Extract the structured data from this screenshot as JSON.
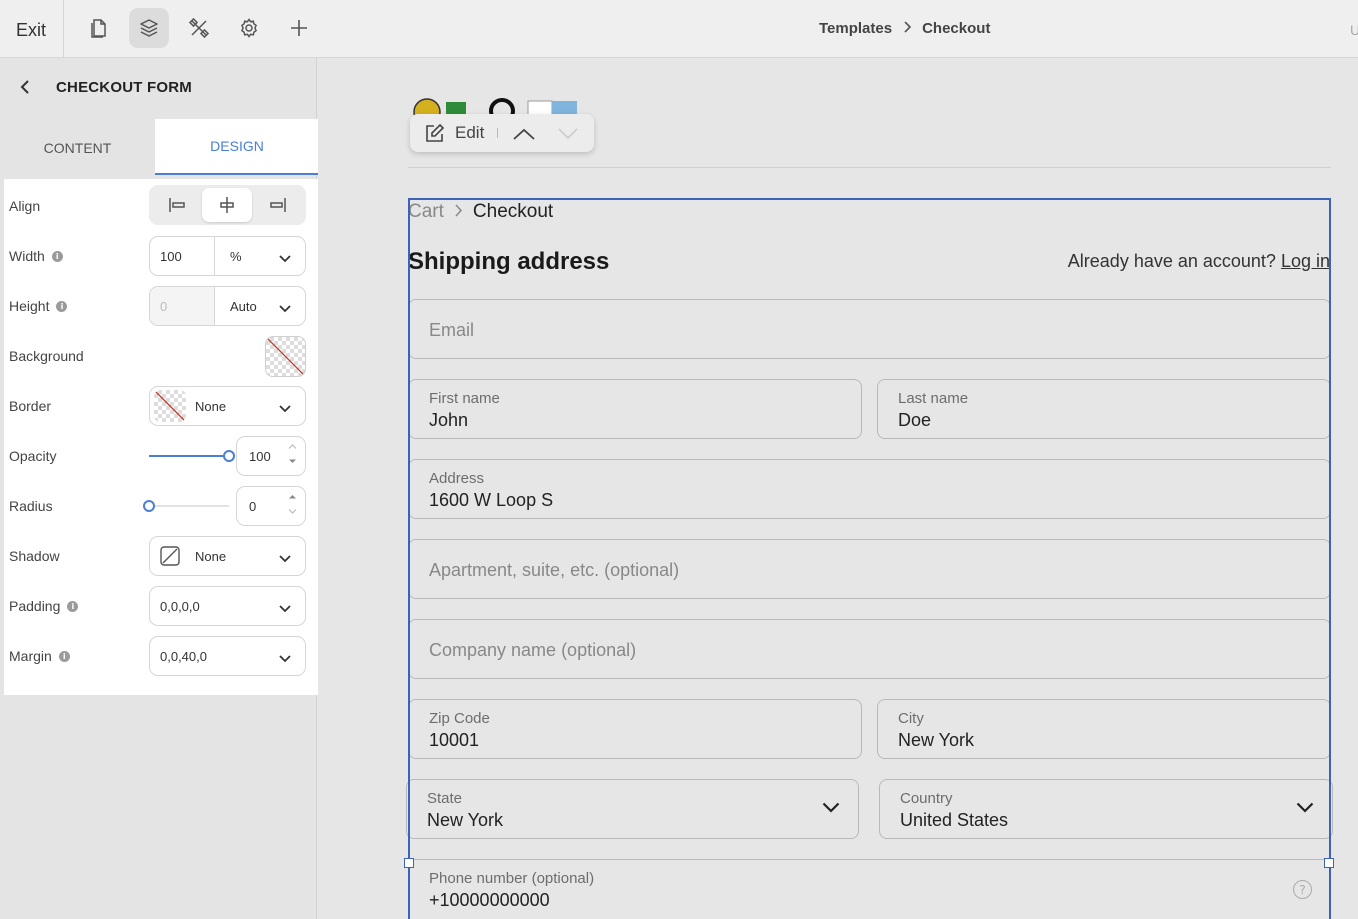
{
  "topbar": {
    "exit_label": "Exit",
    "icons": [
      "pages-icon",
      "layers-icon",
      "tools-icon",
      "settings-gear-icon",
      "plus-icon"
    ],
    "breadcrumb": {
      "parent": "Templates",
      "current": "Checkout"
    },
    "truncated_right": "U"
  },
  "panel": {
    "title": "CHECKOUT FORM",
    "tabs": {
      "content": "CONTENT",
      "design": "DESIGN"
    },
    "active_tab": "DESIGN",
    "props": {
      "align": {
        "label": "Align",
        "selected": "center"
      },
      "width": {
        "label": "Width",
        "value": "100",
        "unit": "%"
      },
      "height": {
        "label": "Height",
        "placeholder": "0",
        "unit": "Auto"
      },
      "background": {
        "label": "Background"
      },
      "border": {
        "label": "Border",
        "value": "None"
      },
      "opacity": {
        "label": "Opacity",
        "value": "100",
        "level": 100
      },
      "radius": {
        "label": "Radius",
        "value": "0",
        "level": 0
      },
      "shadow": {
        "label": "Shadow",
        "value": "None"
      },
      "padding": {
        "label": "Padding",
        "value": "0,0,0,0"
      },
      "margin": {
        "label": "Margin",
        "value": "0,0,40,0"
      }
    }
  },
  "canvas": {
    "edit_label": "Edit",
    "breadcrumb": {
      "cart": "Cart",
      "current": "Checkout"
    },
    "heading": "Shipping address",
    "account_prompt": "Already have an account?",
    "login_link": "Log in",
    "fields": {
      "email": {
        "placeholder": "Email"
      },
      "first_name": {
        "label": "First name",
        "value": "John"
      },
      "last_name": {
        "label": "Last name",
        "value": "Doe"
      },
      "address": {
        "label": "Address",
        "value": "1600 W Loop S"
      },
      "apartment": {
        "placeholder": "Apartment, suite, etc. (optional)"
      },
      "company": {
        "placeholder": "Company name (optional)"
      },
      "zip": {
        "label": "Zip Code",
        "value": "10001"
      },
      "city": {
        "label": "City",
        "value": "New York"
      },
      "state": {
        "label": "State",
        "value": "New York"
      },
      "country": {
        "label": "Country",
        "value": "United States"
      },
      "phone": {
        "label": "Phone number (optional)",
        "value": "+10000000000"
      }
    }
  },
  "colors": {
    "accent": "#4a7fd4",
    "selection": "#3b64b8",
    "canvas_bg": "#e6e6e6"
  }
}
